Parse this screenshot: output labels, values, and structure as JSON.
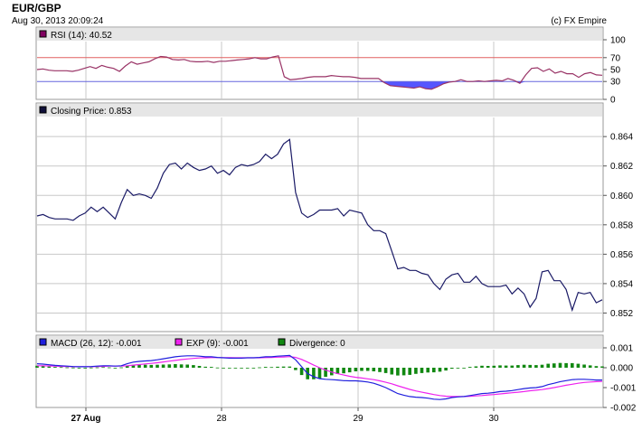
{
  "header": {
    "symbol": "EUR/GBP",
    "timestamp": "Aug 30, 2013 20:09:24",
    "credit": "(c) FX Empire"
  },
  "colors": {
    "panel_header": "#e6e6e6",
    "grid": "#c8c8c8",
    "price": "#1a1a66",
    "rsi": "#993366",
    "rsi_fill": "#5555ff",
    "rsi_70_line": "#e06060",
    "rsi_30_line": "#6666dd",
    "macd": "#1f1fdd",
    "exp": "#ee22ee",
    "divergence": "#118811",
    "rsi_swatch": "#800060",
    "price_swatch": "#10103a"
  },
  "chart_data": [
    {
      "type": "line",
      "panel": "rsi",
      "legend": "RSI (14): 40.52",
      "ylim": [
        0,
        100
      ],
      "yticks": [
        "100",
        "70",
        "50",
        "30",
        "0"
      ],
      "ytick_values": [
        100,
        70,
        50,
        30,
        0
      ],
      "levels": [
        70,
        30
      ],
      "values": [
        50,
        51,
        49,
        48,
        48,
        48,
        47,
        49,
        52,
        55,
        52,
        57,
        54,
        52,
        47,
        56,
        63,
        59,
        61,
        63,
        68,
        72,
        71,
        67,
        66,
        67,
        64,
        63,
        63,
        64,
        62,
        64,
        64,
        65,
        66,
        67,
        68,
        70,
        68,
        68,
        71,
        73,
        38,
        33,
        34,
        35,
        37,
        38,
        38,
        38,
        40,
        39,
        38,
        38,
        37,
        35,
        35,
        35,
        35,
        28,
        23,
        22,
        21,
        20,
        19,
        21,
        18,
        17,
        21,
        26,
        29,
        30,
        33,
        30,
        30,
        31,
        30,
        31,
        32,
        31,
        35,
        32,
        27,
        41,
        52,
        53,
        47,
        51,
        44,
        47,
        43,
        43,
        37,
        43,
        45,
        41,
        40.52
      ]
    },
    {
      "type": "line",
      "panel": "price",
      "legend": "Closing Price: 0.853",
      "ylim": [
        0.8508,
        0.8653
      ],
      "yticks": [
        "0.864",
        "0.862",
        "0.860",
        "0.858",
        "0.856",
        "0.854",
        "0.852"
      ],
      "ytick_values": [
        0.864,
        0.862,
        0.86,
        0.858,
        0.856,
        0.854,
        0.852
      ],
      "values": [
        0.8586,
        0.8587,
        0.8585,
        0.8584,
        0.8584,
        0.8584,
        0.8583,
        0.8586,
        0.8588,
        0.8592,
        0.8589,
        0.8592,
        0.8588,
        0.8584,
        0.8595,
        0.8604,
        0.86,
        0.8601,
        0.86,
        0.8598,
        0.8605,
        0.8615,
        0.8621,
        0.8622,
        0.8618,
        0.8622,
        0.8619,
        0.8617,
        0.8618,
        0.862,
        0.8615,
        0.8617,
        0.8614,
        0.8619,
        0.8621,
        0.862,
        0.8621,
        0.8623,
        0.8628,
        0.8625,
        0.8628,
        0.8635,
        0.8638,
        0.8602,
        0.8588,
        0.8585,
        0.8587,
        0.859,
        0.859,
        0.859,
        0.8591,
        0.8586,
        0.859,
        0.8589,
        0.8588,
        0.858,
        0.8576,
        0.8576,
        0.8574,
        0.8562,
        0.855,
        0.8551,
        0.8549,
        0.8549,
        0.8547,
        0.8546,
        0.854,
        0.8536,
        0.8543,
        0.8546,
        0.8547,
        0.8541,
        0.8541,
        0.8545,
        0.854,
        0.8538,
        0.8538,
        0.8538,
        0.8539,
        0.8533,
        0.8537,
        0.8533,
        0.8524,
        0.853,
        0.8548,
        0.8549,
        0.8542,
        0.8542,
        0.8536,
        0.8522,
        0.8534,
        0.8533,
        0.8534,
        0.8527,
        0.8529
      ]
    },
    {
      "type": "line+bar",
      "panel": "macd",
      "ylim": [
        -0.002,
        0.001
      ],
      "yticks": [
        "0.001",
        "0.000",
        "-0.001",
        "-0.002"
      ],
      "ytick_values": [
        0.001,
        0.0,
        -0.001,
        -0.002
      ],
      "series": [
        {
          "name": "MACD (26, 12): -0.001",
          "type": "line",
          "values": [
            0.0002,
            0.00018,
            0.00015,
            0.00012,
            0.0001,
            8e-05,
            6e-05,
            5e-05,
            5e-05,
            6e-05,
            8e-05,
            0.0001,
            0.0001,
            8e-05,
            0.0001,
            0.0002,
            0.00028,
            0.00032,
            0.00034,
            0.00036,
            0.0004,
            0.00045,
            0.0005,
            0.00055,
            0.00058,
            0.0006,
            0.0006,
            0.00058,
            0.00055,
            0.00055,
            0.00052,
            0.0005,
            0.00048,
            0.00048,
            0.00048,
            0.0005,
            0.0005,
            0.00052,
            0.00055,
            0.00055,
            0.00058,
            0.0006,
            0.00062,
            0.0004,
            5e-05,
            -0.0003,
            -0.00045,
            -0.00055,
            -0.00058,
            -0.0006,
            -0.00062,
            -0.00065,
            -0.00066,
            -0.00066,
            -0.00068,
            -0.00072,
            -0.00078,
            -0.00088,
            -0.001,
            -0.00115,
            -0.0013,
            -0.00138,
            -0.00145,
            -0.00148,
            -0.0015,
            -0.00153,
            -0.00158,
            -0.0016,
            -0.00157,
            -0.0015,
            -0.00147,
            -0.00145,
            -0.0014,
            -0.00135,
            -0.0013,
            -0.00128,
            -0.00125,
            -0.0012,
            -0.00118,
            -0.00115,
            -0.0011,
            -0.00105,
            -0.00102,
            -0.001,
            -0.00095,
            -0.00085,
            -0.00078,
            -0.0007,
            -0.00065,
            -0.0006,
            -0.00058,
            -0.00058,
            -0.0006,
            -0.00062,
            -0.00062
          ]
        },
        {
          "name": "EXP (9): -0.001",
          "type": "line",
          "values": [
            0.0001,
            0.0001,
            9e-05,
            8e-05,
            7e-05,
            6e-05,
            5e-05,
            5e-05,
            5e-05,
            5e-05,
            6e-05,
            7e-05,
            8e-05,
            8e-05,
            8e-05,
            0.0001,
            0.00013,
            0.00016,
            0.00019,
            0.00022,
            0.00025,
            0.00029,
            0.00033,
            0.00037,
            0.00041,
            0.00044,
            0.00047,
            0.00049,
            0.0005,
            0.00051,
            0.00051,
            0.00051,
            0.00051,
            0.0005,
            0.0005,
            0.0005,
            0.0005,
            0.0005,
            0.00051,
            0.00052,
            0.00053,
            0.00054,
            0.00056,
            0.00052,
            0.00042,
            0.00028,
            0.00013,
            0.0,
            -0.00012,
            -0.00022,
            -0.0003,
            -0.00037,
            -0.00043,
            -0.00048,
            -0.00052,
            -0.00056,
            -0.0006,
            -0.00066,
            -0.00073,
            -0.00081,
            -0.00091,
            -0.001,
            -0.00109,
            -0.00117,
            -0.00123,
            -0.00129,
            -0.00135,
            -0.0014,
            -0.00143,
            -0.00145,
            -0.00145,
            -0.00145,
            -0.00144,
            -0.00142,
            -0.0014,
            -0.00137,
            -0.00135,
            -0.00132,
            -0.00129,
            -0.00126,
            -0.00123,
            -0.0012,
            -0.00116,
            -0.00113,
            -0.0011,
            -0.00105,
            -0.001,
            -0.00094,
            -0.00088,
            -0.00083,
            -0.00078,
            -0.00074,
            -0.00072,
            -0.0007,
            -0.00069
          ]
        },
        {
          "name": "Divergence: 0",
          "type": "bar",
          "values": [
            0.0001,
            8e-05,
            6e-05,
            4e-05,
            3e-05,
            2e-05,
            1e-05,
            0.0,
            0.0,
            1e-05,
            2e-05,
            3e-05,
            2e-05,
            0.0,
            2e-05,
            0.0001,
            0.00015,
            0.00016,
            0.00015,
            0.00014,
            0.00015,
            0.00016,
            0.00017,
            0.00018,
            0.00017,
            0.00016,
            0.00013,
            9e-05,
            5e-05,
            4e-05,
            1e-05,
            -1e-05,
            -3e-05,
            -2e-05,
            -2e-05,
            0.0,
            0.0,
            2e-05,
            4e-05,
            3e-05,
            5e-05,
            6e-05,
            6e-05,
            -0.00012,
            -0.00037,
            -0.00058,
            -0.00058,
            -0.00055,
            -0.00046,
            -0.00038,
            -0.00032,
            -0.00028,
            -0.00023,
            -0.00018,
            -0.00016,
            -0.00016,
            -0.00018,
            -0.00022,
            -0.00027,
            -0.00034,
            -0.00039,
            -0.00038,
            -0.00036,
            -0.00031,
            -0.00027,
            -0.00024,
            -0.00023,
            -0.0002,
            -0.00014,
            -5e-05,
            -2e-05,
            0.0,
            4e-05,
            7e-05,
            0.0001,
            9e-05,
            0.0001,
            0.00012,
            0.00011,
            0.00011,
            0.00013,
            0.00015,
            0.00014,
            0.00013,
            0.00015,
            0.0002,
            0.00022,
            0.00024,
            0.00023,
            0.00023,
            0.0002,
            0.00016,
            0.00012,
            8e-05,
            7e-05
          ]
        }
      ]
    }
  ],
  "x_axis": {
    "labels": [
      "27 Aug",
      "28",
      "29",
      "30"
    ],
    "positions": [
      8.5,
      33.5,
      58.5,
      83.5
    ],
    "bold_first": true
  }
}
